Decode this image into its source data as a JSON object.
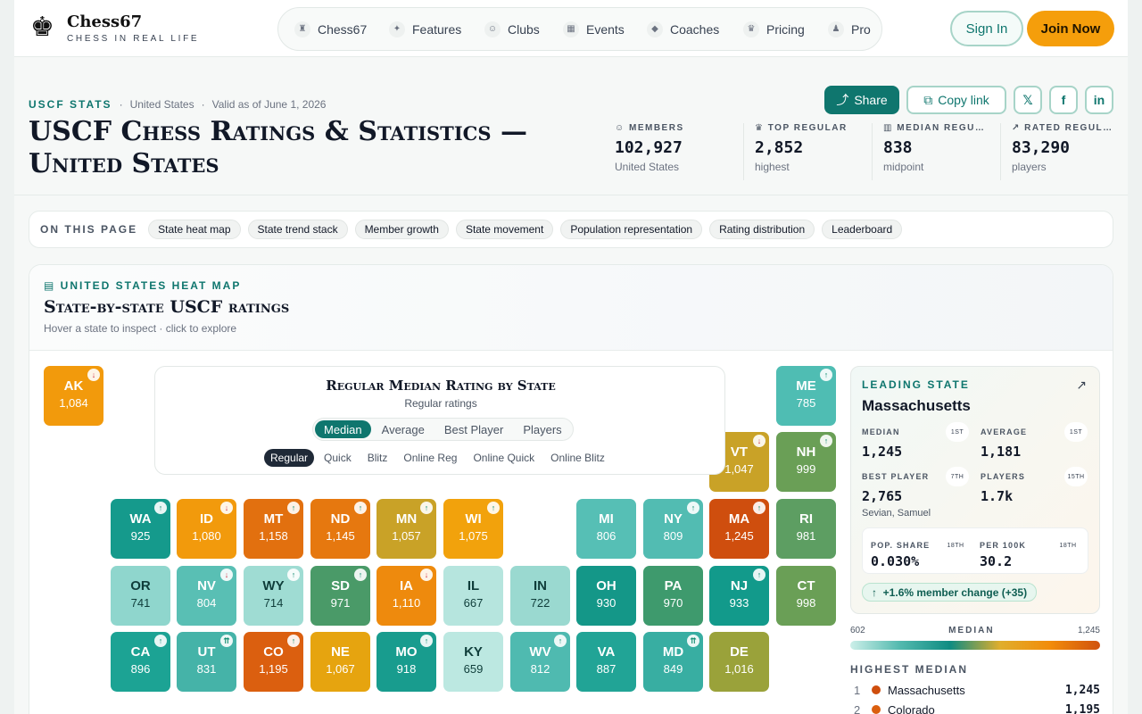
{
  "header": {
    "logo_glyph": "♚",
    "brand": "Chess67",
    "tagline": "CHESS IN REAL LIFE",
    "nav": [
      {
        "label": "Chess67",
        "icon": "rook-icon"
      },
      {
        "label": "Features",
        "icon": "sparkle-icon"
      },
      {
        "label": "Clubs",
        "icon": "users-icon"
      },
      {
        "label": "Events",
        "icon": "calendar-icon"
      },
      {
        "label": "Coaches",
        "icon": "graduation-cap-icon"
      },
      {
        "label": "Pricing",
        "icon": "crown-icon"
      },
      {
        "label": "Pro",
        "icon": "pawn-icon"
      }
    ],
    "sign_in": "Sign In",
    "join": "Join Now"
  },
  "breadcrumb": {
    "kicker": "USCF STATS",
    "country": "United States",
    "valid": "Valid as of June 1, 2026"
  },
  "title": "USCF Chess Ratings & Statistics — United States",
  "share": {
    "share": "Share",
    "copy": "Copy link",
    "x": "𝕏",
    "facebook": "f",
    "linkedin": "in"
  },
  "stats": [
    {
      "label": "MEMBERS",
      "value": "102,927",
      "sub": "United States",
      "icon": "users-icon"
    },
    {
      "label": "TOP REGULAR",
      "value": "2,852",
      "sub": "highest",
      "icon": "crown-icon"
    },
    {
      "label": "MEDIAN REGU…",
      "value": "838",
      "sub": "midpoint",
      "icon": "bar-chart-icon"
    },
    {
      "label": "RATED REGUL…",
      "value": "83,290",
      "sub": "players",
      "icon": "trend-up-icon"
    }
  ],
  "toc": {
    "label": "ON THIS PAGE",
    "items": [
      "State heat map",
      "State trend stack",
      "Member growth",
      "State movement",
      "Population representation",
      "Rating distribution",
      "Leaderboard"
    ]
  },
  "panel": {
    "kicker": "UNITED STATES HEAT MAP",
    "title": "State-by-state USCF ratings",
    "subtitle": "Hover a state to inspect · click to explore"
  },
  "controls": {
    "title": "Regular Median Rating by State",
    "subtitle": "Regular ratings",
    "metrics": [
      "Median",
      "Average",
      "Best Player",
      "Players"
    ],
    "metric_selected": "Median",
    "types": [
      "Regular",
      "Quick",
      "Blitz",
      "Online Reg",
      "Online Quick",
      "Online Blitz"
    ],
    "type_selected": "Regular"
  },
  "tiles": [
    {
      "ab": "AK",
      "v": "1,084",
      "c": "#f29a0c",
      "t": "down"
    },
    {
      "ab": "ME",
      "v": "785",
      "c": "#4fbdb3",
      "t": "up"
    },
    {
      "ab": "VT",
      "v": "1,047",
      "c": "#c9a227",
      "t": "down"
    },
    {
      "ab": "NH",
      "v": "999",
      "c": "#6a9f56",
      "t": "up"
    },
    {
      "ab": "WA",
      "v": "925",
      "c": "#159a8c",
      "t": "up"
    },
    {
      "ab": "ID",
      "v": "1,080",
      "c": "#f29a0c",
      "t": "down"
    },
    {
      "ab": "MT",
      "v": "1,158",
      "c": "#e2700f",
      "t": "up"
    },
    {
      "ab": "ND",
      "v": "1,145",
      "c": "#e6780f",
      "t": "up"
    },
    {
      "ab": "MN",
      "v": "1,057",
      "c": "#c9a227",
      "t": "up"
    },
    {
      "ab": "WI",
      "v": "1,075",
      "c": "#f2a20c",
      "t": "up"
    },
    {
      "ab": "MI",
      "v": "806",
      "c": "#56bfb5",
      "t": ""
    },
    {
      "ab": "NY",
      "v": "809",
      "c": "#52bcb2",
      "t": "up"
    },
    {
      "ab": "MA",
      "v": "1,245",
      "c": "#cf4e0e",
      "t": "up"
    },
    {
      "ab": "RI",
      "v": "981",
      "c": "#5d9e62",
      "t": ""
    },
    {
      "ab": "OR",
      "v": "741",
      "c": "#8fd6cd",
      "t": ""
    },
    {
      "ab": "NV",
      "v": "804",
      "c": "#59bfb4",
      "t": "down"
    },
    {
      "ab": "WY",
      "v": "714",
      "c": "#9fdcd3",
      "t": "up"
    },
    {
      "ab": "SD",
      "v": "971",
      "c": "#4a9a68",
      "t": "up"
    },
    {
      "ab": "IA",
      "v": "1,110",
      "c": "#ee8a0d",
      "t": "down"
    },
    {
      "ab": "IL",
      "v": "667",
      "c": "#b6e5de",
      "t": ""
    },
    {
      "ab": "IN",
      "v": "722",
      "c": "#9ad9d0",
      "t": ""
    },
    {
      "ab": "OH",
      "v": "930",
      "c": "#149788",
      "t": ""
    },
    {
      "ab": "PA",
      "v": "970",
      "c": "#3e9a6d",
      "t": ""
    },
    {
      "ab": "NJ",
      "v": "933",
      "c": "#129a8b",
      "t": "up"
    },
    {
      "ab": "CT",
      "v": "998",
      "c": "#6a9f56",
      "t": ""
    },
    {
      "ab": "CA",
      "v": "896",
      "c": "#1ca394",
      "t": "up"
    },
    {
      "ab": "UT",
      "v": "831",
      "c": "#45b3a8",
      "t": "up2"
    },
    {
      "ab": "CO",
      "v": "1,195",
      "c": "#db5f0f",
      "t": "up"
    },
    {
      "ab": "NE",
      "v": "1,067",
      "c": "#e6a40f",
      "t": ""
    },
    {
      "ab": "MO",
      "v": "918",
      "c": "#189c8e",
      "t": "up"
    },
    {
      "ab": "KY",
      "v": "659",
      "c": "#bce8e1",
      "t": ""
    },
    {
      "ab": "WV",
      "v": "812",
      "c": "#4fbab0",
      "t": "up"
    },
    {
      "ab": "VA",
      "v": "887",
      "c": "#21a496",
      "t": ""
    },
    {
      "ab": "MD",
      "v": "849",
      "c": "#38aea2",
      "t": "up2"
    },
    {
      "ab": "DE",
      "v": "1,016",
      "c": "#9aa23a",
      "t": ""
    }
  ],
  "leading": {
    "kicker": "LEADING STATE",
    "name": "Massachusetts",
    "cells": [
      {
        "label": "MEDIAN",
        "value": "1,245",
        "rank": "1ST",
        "sub": ""
      },
      {
        "label": "AVERAGE",
        "value": "1,181",
        "rank": "1ST",
        "sub": ""
      },
      {
        "label": "BEST PLAYER",
        "value": "2,765",
        "rank": "7TH",
        "sub": "Sevian, Samuel"
      },
      {
        "label": "PLAYERS",
        "value": "1.7k",
        "rank": "15TH",
        "sub": ""
      }
    ],
    "pop": [
      {
        "label": "POP. SHARE",
        "value": "0.030%",
        "rank": "18TH"
      },
      {
        "label": "PER 100K",
        "value": "30.2",
        "rank": "18TH"
      }
    ],
    "change": "+1.6% member change (+35)"
  },
  "scale": {
    "min": "602",
    "label": "MEDIAN",
    "max": "1,245"
  },
  "highest": {
    "label": "HIGHEST MEDIAN",
    "items": [
      {
        "rank": "1",
        "name": "Massachusetts",
        "value": "1,245",
        "color": "#cf4e0e"
      },
      {
        "rank": "2",
        "name": "Colorado",
        "value": "1,195",
        "color": "#db5f0f"
      }
    ]
  }
}
